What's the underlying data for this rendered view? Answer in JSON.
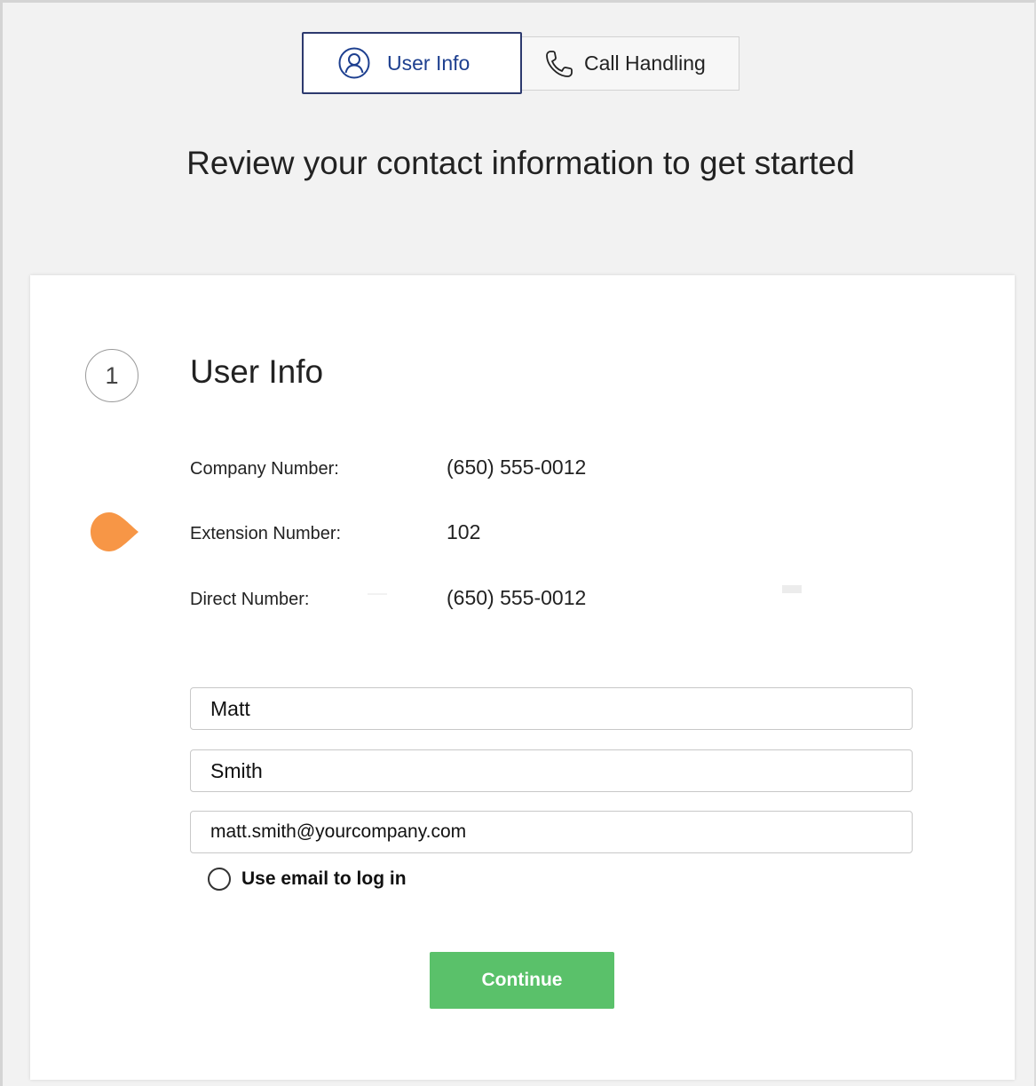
{
  "tabs": [
    {
      "label": "User Info",
      "icon": "user-circle-icon",
      "active": true
    },
    {
      "label": "Call Handling",
      "icon": "phone-icon",
      "active": false
    }
  ],
  "page": {
    "title": "Review your contact information to get started"
  },
  "section": {
    "step_number": "1",
    "title": "User Info",
    "info": [
      {
        "label": "Company Number:",
        "value": "(650) 555-0012"
      },
      {
        "label": "Extension Number:",
        "value": "102"
      },
      {
        "label": "Direct Number:",
        "value": "(650) 555-0012"
      }
    ],
    "fields": {
      "first_name": "Matt",
      "last_name": "Smith",
      "email": "matt.smith@yourcompany.com"
    },
    "use_email_label": "Use email to log in",
    "continue_label": "Continue"
  },
  "colors": {
    "accent_blue": "#1d3f8f",
    "tab_border": "#2d3a6e",
    "pin_orange": "#f79646",
    "button_green": "#5ac16a"
  }
}
